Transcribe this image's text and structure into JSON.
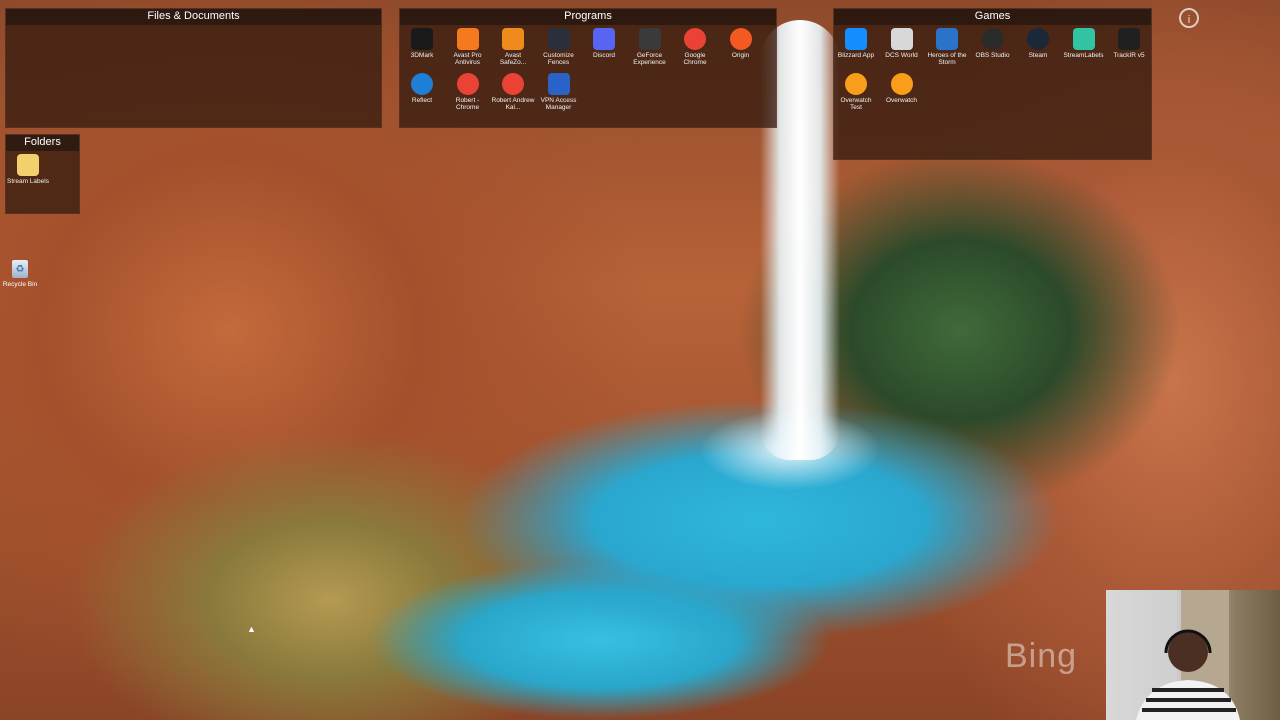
{
  "panels": {
    "files": {
      "title": "Files & Documents"
    },
    "programs": {
      "title": "Programs",
      "items": [
        {
          "label": "3DMark",
          "icon": "3dmark-icon",
          "color": "#1a1a1a"
        },
        {
          "label": "Avast Pro Antivirus",
          "icon": "avast-icon",
          "color": "#f57a1e"
        },
        {
          "label": "Avast SafeZo...",
          "icon": "avast-safezone-icon",
          "color": "#ef8b1a"
        },
        {
          "label": "Customize Fences",
          "icon": "fences-icon",
          "color": "#2a2f3a"
        },
        {
          "label": "Discord",
          "icon": "discord-icon",
          "color": "#5865f2"
        },
        {
          "label": "GeForce Experience",
          "icon": "geforce-icon",
          "color": "#3a3a3a"
        },
        {
          "label": "Google Chrome",
          "icon": "chrome-icon",
          "color": "#ea4335"
        },
        {
          "label": "Origin",
          "icon": "origin-icon",
          "color": "#f25a22"
        },
        {
          "label": "Reflect",
          "icon": "reflect-icon",
          "color": "#1d7fd6"
        },
        {
          "label": "Robert - Chrome",
          "icon": "chrome-icon",
          "color": "#ea4335"
        },
        {
          "label": "Robert Andrew Kal...",
          "icon": "chrome-icon",
          "color": "#ea4335"
        },
        {
          "label": "VPN Access Manager",
          "icon": "vpn-icon",
          "color": "#2a62c8"
        }
      ]
    },
    "games": {
      "title": "Games",
      "items": [
        {
          "label": "Blizzard App",
          "icon": "blizzard-icon",
          "color": "#148eff"
        },
        {
          "label": "DCS World",
          "icon": "dcs-icon",
          "color": "#d8d8d8"
        },
        {
          "label": "Heroes of the Storm",
          "icon": "heroes-icon",
          "color": "#2a73c9"
        },
        {
          "label": "OBS Studio",
          "icon": "obs-icon",
          "color": "#2b2b2b"
        },
        {
          "label": "Steam",
          "icon": "steam-icon",
          "color": "#1b2838"
        },
        {
          "label": "StreamLabels",
          "icon": "streamlabels-icon",
          "color": "#31c3a2"
        },
        {
          "label": "TrackIR v5",
          "icon": "trackir-icon",
          "color": "#202020"
        },
        {
          "label": "Overwatch Test",
          "icon": "overwatch-icon",
          "color": "#f99e1a"
        },
        {
          "label": "Overwatch",
          "icon": "overwatch-icon",
          "color": "#f99e1a"
        }
      ]
    },
    "folders": {
      "title": "Folders",
      "items": [
        {
          "label": "Stream Labels",
          "icon": "folder-icon",
          "color": "#f2d06b"
        }
      ]
    }
  },
  "desktop": {
    "recycle_bin": "Recycle Bin",
    "bing_watermark": "Bing"
  }
}
